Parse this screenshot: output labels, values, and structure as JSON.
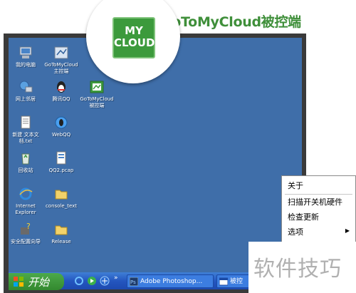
{
  "header": {
    "title": "GoToMyCloud被控端"
  },
  "badge": {
    "line1": "MY",
    "line2": "CLOUD"
  },
  "desktop_icons": [
    {
      "label": "我的电脑"
    },
    {
      "label": "GoToMyCloud\n主控端"
    },
    {
      "label": "网上邻居"
    },
    {
      "label": "腾讯QQ"
    },
    {
      "label": "GoToMyCloud\n被控端"
    },
    {
      "label": "新建 文本文\n档.txt"
    },
    {
      "label": "WebQQ"
    },
    {
      "label": "回收站"
    },
    {
      "label": "QQ2.pcap"
    },
    {
      "label": "Internet\nExplorer"
    },
    {
      "label": "console_text"
    },
    {
      "label": "安全配置向导"
    },
    {
      "label": "Release"
    }
  ],
  "context_menu": {
    "items": [
      {
        "label": "关于"
      },
      {
        "label": "扫描开关机硬件"
      },
      {
        "label": "检查更新"
      },
      {
        "label": "选项"
      }
    ],
    "submenu_arrow": "▶"
  },
  "taskbar": {
    "start_label": "开始",
    "chevron": "»",
    "tasks": [
      {
        "label": "Adobe Photoshop...",
        "icon": "photoshop-icon"
      },
      {
        "label": "被控",
        "icon": "window-icon"
      }
    ]
  },
  "watermark": "软件技巧",
  "colors": {
    "desktop": "#3f6ea9",
    "brand_green": "#3c9a3c",
    "title_green": "#3f8f3a",
    "taskbar": "#2456bf",
    "start_button": "#33892f"
  }
}
